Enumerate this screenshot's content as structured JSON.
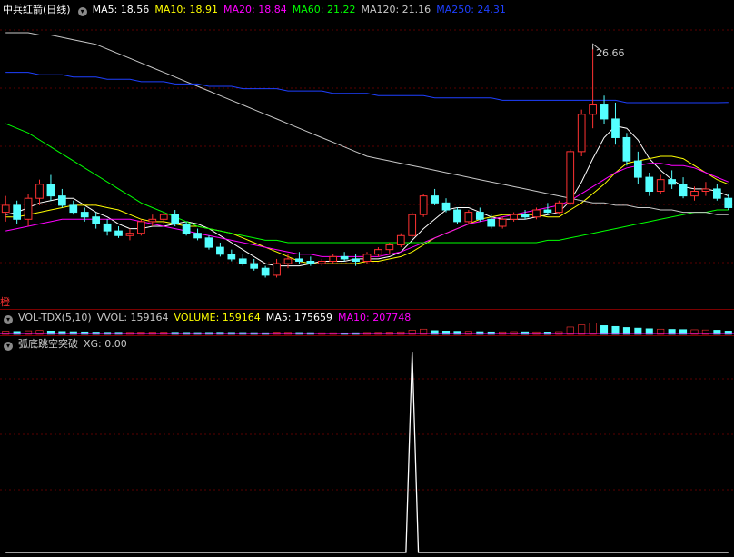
{
  "main": {
    "title": "中兵红箭(日线)",
    "indicators": [
      {
        "label": "MA5:",
        "value": "18.56",
        "color": "#ffffff"
      },
      {
        "label": "MA10:",
        "value": "18.91",
        "color": "#ffff00"
      },
      {
        "label": "MA20:",
        "value": "18.84",
        "color": "#ff00ff"
      },
      {
        "label": "MA60:",
        "value": "21.22",
        "color": "#00ff00"
      },
      {
        "label": "MA120:",
        "value": "21.16",
        "color": "#c8c8c8"
      },
      {
        "label": "MA250:",
        "value": "24.31",
        "color": "#1e40ff"
      }
    ],
    "high_label": "26.66",
    "side_glyph": "橙"
  },
  "volume": {
    "title": "VOL-TDX(5,10)",
    "indicators": [
      {
        "label": "VVOL:",
        "value": "159164",
        "color": "#c8c8c8"
      },
      {
        "label": "VOLUME:",
        "value": "159164",
        "color": "#ffff00"
      },
      {
        "label": "MA5:",
        "value": "175659",
        "color": "#ffffff"
      },
      {
        "label": "MA10:",
        "value": "207748",
        "color": "#ff00ff"
      }
    ]
  },
  "signal": {
    "title": "弧底跳空突破",
    "indicators": [
      {
        "label": "XG:",
        "value": "0.00",
        "color": "#c8c8c8"
      }
    ]
  },
  "chart_data": [
    {
      "type": "candlestick",
      "title": "中兵红箭(日线)",
      "ylim": [
        16.0,
        28.0
      ],
      "annotations": [
        {
          "label": "26.66",
          "value": 26.66
        }
      ],
      "series": [
        {
          "name": "K",
          "ohlc": [
            [
              19.6,
              20.3,
              19.2,
              19.9
            ],
            [
              19.9,
              20.1,
              19.1,
              19.3
            ],
            [
              19.3,
              20.4,
              19.0,
              20.2
            ],
            [
              20.2,
              21.0,
              19.9,
              20.8
            ],
            [
              20.8,
              21.2,
              20.1,
              20.3
            ],
            [
              20.3,
              20.6,
              19.8,
              19.9
            ],
            [
              19.9,
              20.1,
              19.5,
              19.6
            ],
            [
              19.6,
              19.8,
              19.2,
              19.4
            ],
            [
              19.4,
              19.6,
              18.9,
              19.1
            ],
            [
              19.1,
              19.3,
              18.6,
              18.8
            ],
            [
              18.8,
              19.0,
              18.5,
              18.6
            ],
            [
              18.6,
              18.9,
              18.4,
              18.7
            ],
            [
              18.7,
              19.3,
              18.6,
              19.2
            ],
            [
              19.2,
              19.5,
              19.0,
              19.3
            ],
            [
              19.3,
              19.6,
              19.1,
              19.5
            ],
            [
              19.5,
              19.7,
              19.0,
              19.1
            ],
            [
              19.1,
              19.2,
              18.6,
              18.7
            ],
            [
              18.7,
              18.9,
              18.4,
              18.5
            ],
            [
              18.5,
              18.6,
              18.0,
              18.1
            ],
            [
              18.1,
              18.3,
              17.7,
              17.8
            ],
            [
              17.8,
              18.0,
              17.5,
              17.6
            ],
            [
              17.6,
              17.8,
              17.3,
              17.4
            ],
            [
              17.4,
              17.6,
              17.1,
              17.2
            ],
            [
              17.2,
              17.3,
              16.8,
              16.9
            ],
            [
              16.9,
              17.6,
              16.8,
              17.4
            ],
            [
              17.4,
              17.8,
              17.2,
              17.6
            ],
            [
              17.6,
              17.9,
              17.4,
              17.5
            ],
            [
              17.5,
              17.7,
              17.3,
              17.4
            ],
            [
              17.4,
              17.6,
              17.3,
              17.5
            ],
            [
              17.5,
              17.8,
              17.4,
              17.7
            ],
            [
              17.7,
              17.9,
              17.5,
              17.6
            ],
            [
              17.6,
              17.8,
              17.3,
              17.5
            ],
            [
              17.5,
              17.9,
              17.4,
              17.8
            ],
            [
              17.8,
              18.1,
              17.7,
              18.0
            ],
            [
              18.0,
              18.3,
              17.8,
              18.2
            ],
            [
              18.2,
              18.7,
              18.1,
              18.6
            ],
            [
              18.6,
              19.6,
              18.5,
              19.5
            ],
            [
              19.5,
              20.4,
              19.4,
              20.3
            ],
            [
              20.3,
              20.6,
              19.9,
              20.0
            ],
            [
              20.0,
              20.2,
              19.6,
              19.7
            ],
            [
              19.7,
              19.8,
              19.1,
              19.2
            ],
            [
              19.2,
              19.7,
              19.1,
              19.6
            ],
            [
              19.6,
              19.8,
              19.2,
              19.3
            ],
            [
              19.3,
              19.5,
              18.9,
              19.0
            ],
            [
              19.0,
              19.4,
              18.9,
              19.3
            ],
            [
              19.3,
              19.6,
              19.2,
              19.5
            ],
            [
              19.5,
              19.7,
              19.3,
              19.4
            ],
            [
              19.4,
              19.8,
              19.3,
              19.7
            ],
            [
              19.7,
              20.0,
              19.5,
              19.6
            ],
            [
              19.6,
              20.1,
              19.5,
              20.0
            ],
            [
              20.0,
              22.3,
              19.9,
              22.2
            ],
            [
              22.2,
              24.0,
              22.0,
              23.8
            ],
            [
              23.8,
              26.66,
              23.2,
              24.2
            ],
            [
              24.2,
              24.6,
              23.4,
              23.6
            ],
            [
              23.6,
              24.3,
              22.5,
              22.8
            ],
            [
              22.8,
              23.0,
              21.6,
              21.8
            ],
            [
              21.8,
              22.2,
              20.8,
              21.1
            ],
            [
              21.1,
              21.3,
              20.3,
              20.5
            ],
            [
              20.5,
              21.2,
              20.4,
              21.0
            ],
            [
              21.0,
              21.4,
              20.6,
              20.8
            ],
            [
              20.8,
              21.1,
              20.2,
              20.3
            ],
            [
              20.3,
              20.7,
              20.1,
              20.5
            ],
            [
              20.5,
              20.9,
              20.3,
              20.6
            ],
            [
              20.6,
              20.8,
              20.1,
              20.2
            ],
            [
              20.2,
              20.4,
              19.7,
              19.8
            ]
          ]
        },
        {
          "name": "MA5",
          "values": [
            19.5,
            19.6,
            19.8,
            20.0,
            20.1,
            20.2,
            20.2,
            19.9,
            19.6,
            19.4,
            19.1,
            18.9,
            18.9,
            19.0,
            19.0,
            19.1,
            19.2,
            19.1,
            18.9,
            18.6,
            18.3,
            18.0,
            17.7,
            17.4,
            17.3,
            17.3,
            17.3,
            17.4,
            17.5,
            17.5,
            17.5,
            17.6,
            17.6,
            17.6,
            17.7,
            17.9,
            18.4,
            18.9,
            19.3,
            19.7,
            19.8,
            19.8,
            19.6,
            19.4,
            19.3,
            19.3,
            19.3,
            19.4,
            19.5,
            19.6,
            20.1,
            20.9,
            21.9,
            22.8,
            23.3,
            23.2,
            22.7,
            21.9,
            21.4,
            21.0,
            20.7,
            20.6,
            20.6,
            20.5,
            20.3
          ]
        },
        {
          "name": "MA10",
          "values": [
            19.4,
            19.4,
            19.5,
            19.6,
            19.7,
            19.8,
            19.9,
            19.9,
            19.9,
            19.8,
            19.7,
            19.5,
            19.3,
            19.2,
            19.2,
            19.1,
            19.0,
            19.0,
            18.9,
            18.8,
            18.7,
            18.5,
            18.3,
            18.1,
            17.9,
            17.7,
            17.5,
            17.4,
            17.4,
            17.4,
            17.4,
            17.4,
            17.5,
            17.5,
            17.6,
            17.7,
            17.9,
            18.2,
            18.5,
            18.7,
            18.9,
            19.1,
            19.3,
            19.4,
            19.5,
            19.5,
            19.5,
            19.5,
            19.4,
            19.4,
            19.7,
            20.0,
            20.4,
            20.8,
            21.3,
            21.7,
            21.8,
            21.9,
            22.0,
            22.0,
            21.9,
            21.6,
            21.3,
            21.0,
            20.8
          ]
        },
        {
          "name": "MA20",
          "values": [
            18.8,
            18.9,
            19.0,
            19.1,
            19.2,
            19.3,
            19.3,
            19.3,
            19.3,
            19.3,
            19.3,
            19.3,
            19.2,
            19.1,
            19.0,
            18.9,
            18.8,
            18.7,
            18.6,
            18.5,
            18.4,
            18.3,
            18.2,
            18.1,
            18.0,
            17.9,
            17.8,
            17.8,
            17.7,
            17.7,
            17.7,
            17.7,
            17.7,
            17.7,
            17.8,
            17.9,
            18.1,
            18.3,
            18.5,
            18.7,
            18.9,
            19.1,
            19.2,
            19.3,
            19.4,
            19.5,
            19.6,
            19.7,
            19.8,
            19.9,
            20.1,
            20.4,
            20.7,
            21.0,
            21.3,
            21.5,
            21.6,
            21.7,
            21.7,
            21.6,
            21.6,
            21.5,
            21.3,
            21.1,
            20.9
          ]
        },
        {
          "name": "MA60",
          "values": [
            23.4,
            23.2,
            23.0,
            22.7,
            22.4,
            22.1,
            21.8,
            21.5,
            21.2,
            20.9,
            20.6,
            20.3,
            20.0,
            19.8,
            19.6,
            19.4,
            19.2,
            19.0,
            18.9,
            18.8,
            18.7,
            18.6,
            18.5,
            18.4,
            18.4,
            18.3,
            18.3,
            18.3,
            18.3,
            18.3,
            18.3,
            18.3,
            18.3,
            18.3,
            18.3,
            18.3,
            18.3,
            18.3,
            18.3,
            18.3,
            18.3,
            18.3,
            18.3,
            18.3,
            18.3,
            18.3,
            18.3,
            18.3,
            18.4,
            18.4,
            18.5,
            18.6,
            18.7,
            18.8,
            18.9,
            19.0,
            19.1,
            19.2,
            19.3,
            19.4,
            19.5,
            19.6,
            19.6,
            19.7,
            19.7
          ]
        },
        {
          "name": "MA120",
          "values": [
            27.3,
            27.3,
            27.3,
            27.2,
            27.2,
            27.1,
            27.0,
            26.9,
            26.8,
            26.6,
            26.4,
            26.2,
            26.0,
            25.8,
            25.6,
            25.4,
            25.2,
            25.0,
            24.8,
            24.6,
            24.4,
            24.2,
            24.0,
            23.8,
            23.6,
            23.4,
            23.2,
            23.0,
            22.8,
            22.6,
            22.4,
            22.2,
            22.0,
            21.9,
            21.8,
            21.7,
            21.6,
            21.5,
            21.4,
            21.3,
            21.2,
            21.1,
            21.0,
            20.9,
            20.8,
            20.7,
            20.6,
            20.5,
            20.4,
            20.3,
            20.2,
            20.1,
            20.0,
            20.0,
            19.9,
            19.9,
            19.8,
            19.8,
            19.7,
            19.7,
            19.6,
            19.6,
            19.6,
            19.5,
            19.5
          ]
        },
        {
          "name": "MA250",
          "values": [
            25.6,
            25.6,
            25.6,
            25.5,
            25.5,
            25.5,
            25.4,
            25.4,
            25.4,
            25.3,
            25.3,
            25.3,
            25.2,
            25.2,
            25.2,
            25.1,
            25.1,
            25.1,
            25.0,
            25.0,
            25.0,
            24.9,
            24.9,
            24.9,
            24.9,
            24.8,
            24.8,
            24.8,
            24.8,
            24.7,
            24.7,
            24.7,
            24.7,
            24.6,
            24.6,
            24.6,
            24.6,
            24.6,
            24.5,
            24.5,
            24.5,
            24.5,
            24.5,
            24.5,
            24.4,
            24.4,
            24.4,
            24.4,
            24.4,
            24.4,
            24.4,
            24.4,
            24.4,
            24.4,
            24.4,
            24.3,
            24.3,
            24.3,
            24.3,
            24.3,
            24.3,
            24.3,
            24.3,
            24.3,
            24.31
          ]
        }
      ]
    },
    {
      "type": "bar",
      "title": "VOL-TDX(5,10)",
      "ylim": [
        0,
        1000000
      ],
      "series": [
        {
          "name": "VOLUME",
          "values": [
            150000,
            140000,
            170000,
            190000,
            160000,
            140000,
            130000,
            120000,
            110000,
            100000,
            100000,
            95000,
            110000,
            105000,
            100000,
            100000,
            95000,
            90000,
            95000,
            100000,
            95000,
            90000,
            85000,
            80000,
            100000,
            95000,
            90000,
            85000,
            80000,
            80000,
            75000,
            80000,
            90000,
            95000,
            100000,
            120000,
            200000,
            250000,
            180000,
            160000,
            150000,
            140000,
            130000,
            120000,
            120000,
            130000,
            125000,
            120000,
            115000,
            130000,
            350000,
            450000,
            550000,
            420000,
            380000,
            330000,
            300000,
            270000,
            250000,
            240000,
            230000,
            220000,
            210000,
            200000,
            159164
          ]
        }
      ]
    },
    {
      "type": "line",
      "title": "弧底跳空突破",
      "ylim": [
        0,
        1
      ],
      "series": [
        {
          "name": "XG",
          "values": [
            0,
            0,
            0,
            0,
            0,
            0,
            0,
            0,
            0,
            0,
            0,
            0,
            0,
            0,
            0,
            0,
            0,
            0,
            0,
            0,
            0,
            0,
            0,
            0,
            0,
            0,
            0,
            0,
            0,
            0,
            0,
            0,
            0,
            0,
            0,
            0,
            1,
            0,
            0,
            0,
            0,
            0,
            0,
            0,
            0,
            0,
            0,
            0,
            0,
            0,
            0,
            0,
            0,
            0,
            0,
            0,
            0,
            0,
            0,
            0,
            0,
            0,
            0,
            0,
            0
          ]
        }
      ]
    }
  ]
}
